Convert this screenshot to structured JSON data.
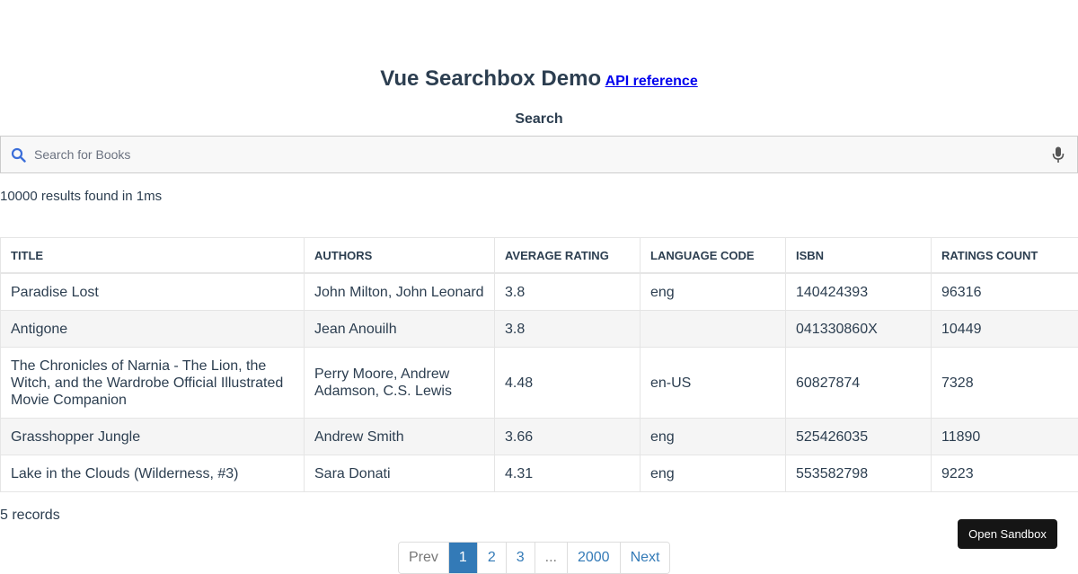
{
  "header": {
    "title": "Vue Searchbox Demo",
    "api_link": "API reference"
  },
  "search": {
    "label": "Search",
    "placeholder": "Search for Books",
    "value": "",
    "icon": "search-icon",
    "mic_icon": "microphone-icon"
  },
  "results": {
    "stats": "10000 results found in 1ms"
  },
  "table": {
    "headers": [
      "TITLE",
      "AUTHORS",
      "AVERAGE RATING",
      "LANGUAGE CODE",
      "ISBN",
      "RATINGS COUNT"
    ],
    "rows": [
      [
        "Paradise Lost",
        "John Milton, John Leonard",
        "3.8",
        "eng",
        "140424393",
        "96316"
      ],
      [
        "Antigone",
        "Jean Anouilh",
        "3.8",
        "",
        "041330860X",
        "10449"
      ],
      [
        "The Chronicles of Narnia - The Lion, the Witch, and the Wardrobe Official Illustrated Movie Companion",
        "Perry Moore, Andrew Adamson, C.S. Lewis",
        "4.48",
        "en-US",
        "60827874",
        "7328"
      ],
      [
        "Grasshopper Jungle",
        "Andrew Smith",
        "3.66",
        "eng",
        "525426035",
        "11890"
      ],
      [
        "Lake in the Clouds (Wilderness, #3)",
        "Sara Donati",
        "4.31",
        "eng",
        "553582798",
        "9223"
      ]
    ]
  },
  "footer": {
    "records": "5 records"
  },
  "pagination": {
    "prev": "Prev",
    "pages": [
      "1",
      "2",
      "3",
      "...",
      "2000"
    ],
    "next": "Next",
    "active_page": "1"
  },
  "sandbox": {
    "label": "Open Sandbox"
  },
  "colors": {
    "text": "#2c3e50",
    "accent": "#337ab7",
    "link": "#0000ee",
    "search_icon": "#3b6ed9",
    "sandbox_bg": "#151515"
  }
}
